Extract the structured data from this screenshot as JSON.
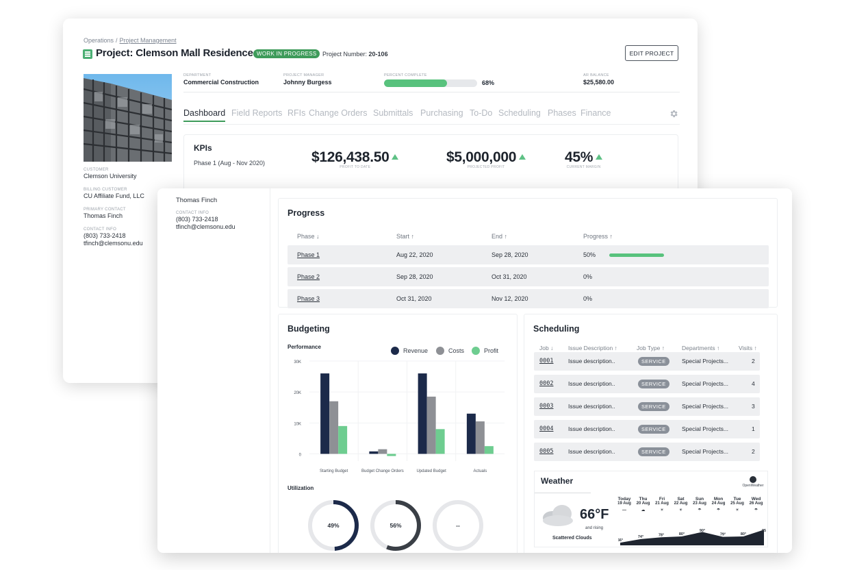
{
  "back": {
    "breadcrumb": {
      "parent": "Operations",
      "separator": "/",
      "current": "Project Management"
    },
    "title": "Project: Clemson Mall Residences",
    "status_badge": "WORK IN PROGRESS",
    "project_number_label": "Project Number:",
    "project_number": "20-106",
    "edit_button": "EDIT PROJECT",
    "meta": {
      "department_label": "DEPARTMENT",
      "department": "Commercial Construction",
      "manager_label": "PROJECT MANAGER",
      "manager": "Johnny Burgess",
      "percent_label": "PERCENT COMPLETE",
      "percent_value": 68,
      "percent_text": "68%",
      "ar_label": "AR BALANCE",
      "ar_balance": "$25,580.00"
    },
    "sidebar": {
      "customer_label": "CUSTOMER",
      "customer": "Clemson University",
      "billing_label": "BILLING CUSTOMER",
      "billing": "CU Affiliate Fund, LLC",
      "contact_label": "PRIMARY CONTACT",
      "contact": "Thomas Finch",
      "info_label": "CONTACT INFO",
      "phone": "(803) 733-2418",
      "email": "tfinch@clemsonu.edu"
    },
    "tabs": [
      "Dashboard",
      "Field Reports",
      "RFIs",
      "Change Orders",
      "Submittals",
      "Purchasing",
      "To-Do",
      "Scheduling",
      "Phases",
      "Finance"
    ],
    "kpis": {
      "title": "KPIs",
      "subtitle": "Phase 1 (Aug - Nov 2020)",
      "items": [
        {
          "value": "$126,438.50",
          "label": "PROFIT TO DATE"
        },
        {
          "value": "$5,000,000",
          "label": "PROJECTED PROFIT"
        },
        {
          "value": "45%",
          "label": "CURRENT MARGIN"
        }
      ]
    }
  },
  "front": {
    "contact_name": "Thomas Finch",
    "contact_label": "CONTACT INFO",
    "contact_phone": "(803) 733-2418",
    "contact_email": "tfinch@clemsonu.edu",
    "progress": {
      "title": "Progress",
      "headers": [
        "Phase ↓",
        "Start ↑",
        "End ↑",
        "Progress ↑"
      ],
      "rows": [
        {
          "phase": "Phase 1",
          "start": "Aug 22, 2020",
          "end": "Sep 28, 2020",
          "progress": "50%",
          "progress_value": 50
        },
        {
          "phase": "Phase 2",
          "start": "Sep 28, 2020",
          "end": "Oct 31, 2020",
          "progress": "0%",
          "progress_value": 0
        },
        {
          "phase": "Phase 3",
          "start": "Oct 31, 2020",
          "end": "Nov 12, 2020",
          "progress": "0%",
          "progress_value": 0
        }
      ]
    },
    "budgeting": {
      "title": "Budgeting",
      "performance_label": "Performance",
      "utilization_label": "Utilization",
      "donuts": [
        {
          "text": "49%",
          "value": 49
        },
        {
          "text": "56%",
          "value": 56
        },
        {
          "text": "--",
          "value": 0
        }
      ]
    },
    "scheduling": {
      "title": "Scheduling",
      "headers": [
        "Job ↓",
        "Issue Description ↑",
        "Job Type ↑",
        "Departments ↑",
        "Visits ↑"
      ],
      "rows": [
        {
          "job": "0001",
          "desc": "Issue description..",
          "type": "SERVICE",
          "dept": "Special Projects...",
          "visits": "2"
        },
        {
          "job": "0002",
          "desc": "Issue description..",
          "type": "SERVICE",
          "dept": "Special Projects...",
          "visits": "4"
        },
        {
          "job": "0003",
          "desc": "Issue description..",
          "type": "SERVICE",
          "dept": "Special Projects...",
          "visits": "3"
        },
        {
          "job": "0004",
          "desc": "Issue description..",
          "type": "SERVICE",
          "dept": "Special Projects...",
          "visits": "1"
        },
        {
          "job": "0005",
          "desc": "Issue description..",
          "type": "SERVICE",
          "dept": "Special Projects...",
          "visits": "2"
        }
      ]
    },
    "weather": {
      "title": "Weather",
      "provider": "OpenWeather",
      "temp": "66°F",
      "trend": "and rising",
      "condition": "Scattered Clouds",
      "days": [
        {
          "day": "Today",
          "date": "19 Aug",
          "icon": "—",
          "temp": "66°"
        },
        {
          "day": "Thu",
          "date": "20 Aug",
          "icon": "☁",
          "temp": "74°"
        },
        {
          "day": "Fri",
          "date": "21 Aug",
          "icon": "☀",
          "temp": "78°"
        },
        {
          "day": "Sat",
          "date": "22 Aug",
          "icon": "☀",
          "temp": "80°"
        },
        {
          "day": "Sun",
          "date": "23 Aug",
          "icon": "☂",
          "temp": "90°"
        },
        {
          "day": "Mon",
          "date": "24 Aug",
          "icon": "☂",
          "temp": "79°"
        },
        {
          "day": "Tue",
          "date": "25 Aug",
          "icon": "☀",
          "temp": "80°"
        },
        {
          "day": "Wed",
          "date": "26 Aug",
          "icon": "☂",
          "temp": "95"
        }
      ]
    }
  },
  "chart_data": {
    "type": "bar",
    "title": "Performance",
    "categories": [
      "Starting Budget",
      "Budget Change Orders",
      "Updated Budget",
      "Actuals"
    ],
    "series": [
      {
        "name": "Revenue",
        "color": "#1c2a4a",
        "values": [
          26000,
          800,
          26000,
          13000
        ]
      },
      {
        "name": "Costs",
        "color": "#8e9095",
        "values": [
          17000,
          1500,
          18500,
          10500
        ]
      },
      {
        "name": "Profit",
        "color": "#6ecd90",
        "values": [
          9000,
          -700,
          8000,
          2500
        ]
      }
    ],
    "yticks": [
      "30K",
      "20K",
      "10K",
      "0"
    ],
    "ylim": [
      -1000,
      30000
    ],
    "legend_position": "top-right",
    "grid": true
  },
  "colors": {
    "accent": "#3e9b5a",
    "progress": "#58c27d",
    "revenue": "#1c2a4a",
    "costs": "#8e9095",
    "profit": "#6ecd90"
  }
}
